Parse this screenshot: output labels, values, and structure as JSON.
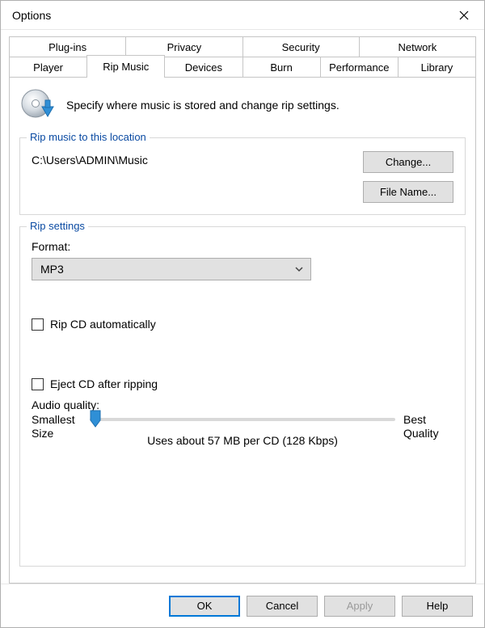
{
  "window": {
    "title": "Options"
  },
  "tabs": {
    "row1": [
      "Plug-ins",
      "Privacy",
      "Security",
      "Network"
    ],
    "row2": [
      "Player",
      "Rip Music",
      "Devices",
      "Burn",
      "Performance",
      "Library"
    ],
    "active": "Rip Music"
  },
  "header": {
    "text": "Specify where music is stored and change rip settings."
  },
  "location_group": {
    "legend": "Rip music to this location",
    "path": "C:\\Users\\ADMIN\\Music",
    "change_btn": "Change...",
    "filename_btn": "File Name..."
  },
  "rip_settings": {
    "legend": "Rip settings",
    "format_label": "Format:",
    "format_value": "MP3",
    "rip_auto_label": "Rip CD automatically",
    "rip_auto_checked": false,
    "eject_label": "Eject CD after ripping",
    "eject_checked": false,
    "audio_quality_label": "Audio quality:",
    "slider": {
      "left_label_1": "Smallest",
      "left_label_2": "Size",
      "right_label_1": "Best",
      "right_label_2": "Quality",
      "position_pct": 0
    },
    "quality_info": "Uses about 57 MB per CD (128 Kbps)"
  },
  "buttons": {
    "ok": "OK",
    "cancel": "Cancel",
    "apply": "Apply",
    "help": "Help"
  }
}
